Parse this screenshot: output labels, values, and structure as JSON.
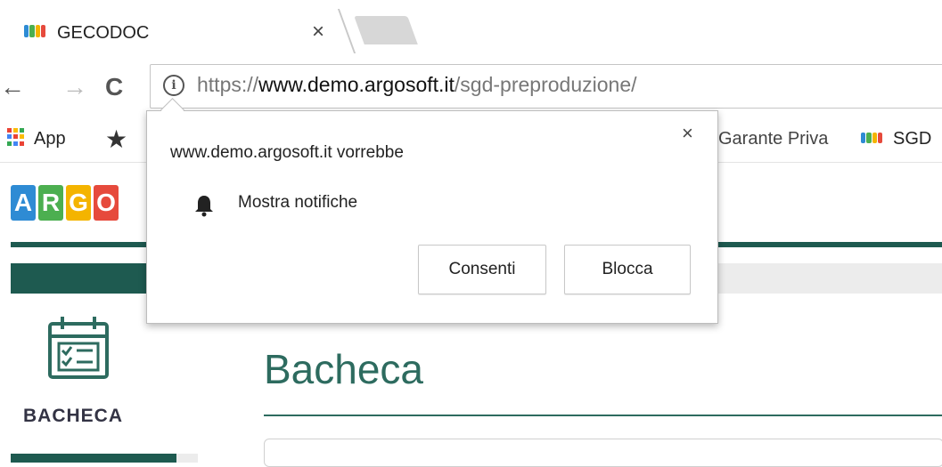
{
  "browser": {
    "tab": {
      "title": "GECODOC",
      "close_glyph": "×"
    },
    "toolbar": {
      "back_glyph": "←",
      "forward_glyph": "→",
      "reload_glyph": "C",
      "url_scheme": "https://",
      "url_host": "www.demo.argosoft.it",
      "url_path": "/sgd-preproduzione/"
    },
    "bookmarks": {
      "apps_label": "App",
      "items": [
        "Garante Priva",
        "SGD"
      ]
    }
  },
  "page": {
    "logo_letters": [
      "A",
      "R",
      "G",
      "O"
    ],
    "logo_colors": [
      "#2e8bd4",
      "#4caf50",
      "#f4b400",
      "#e64a3c"
    ],
    "sidebar_label": "BACHECA",
    "title": "Bacheca"
  },
  "popup": {
    "origin_text": "www.demo.argosoft.it vorrebbe",
    "permission_text": "Mostra notifiche",
    "allow_label": "Consenti",
    "block_label": "Blocca",
    "close_glyph": "×"
  },
  "colors": {
    "accent": "#1e5a50",
    "title": "#2d6b5f"
  },
  "icons": [
    "argo-favicon-icon",
    "close-icon",
    "back-icon",
    "forward-icon",
    "reload-icon",
    "info-icon",
    "apps-icon",
    "star-icon",
    "bell-icon",
    "calendar-checklist-icon"
  ]
}
